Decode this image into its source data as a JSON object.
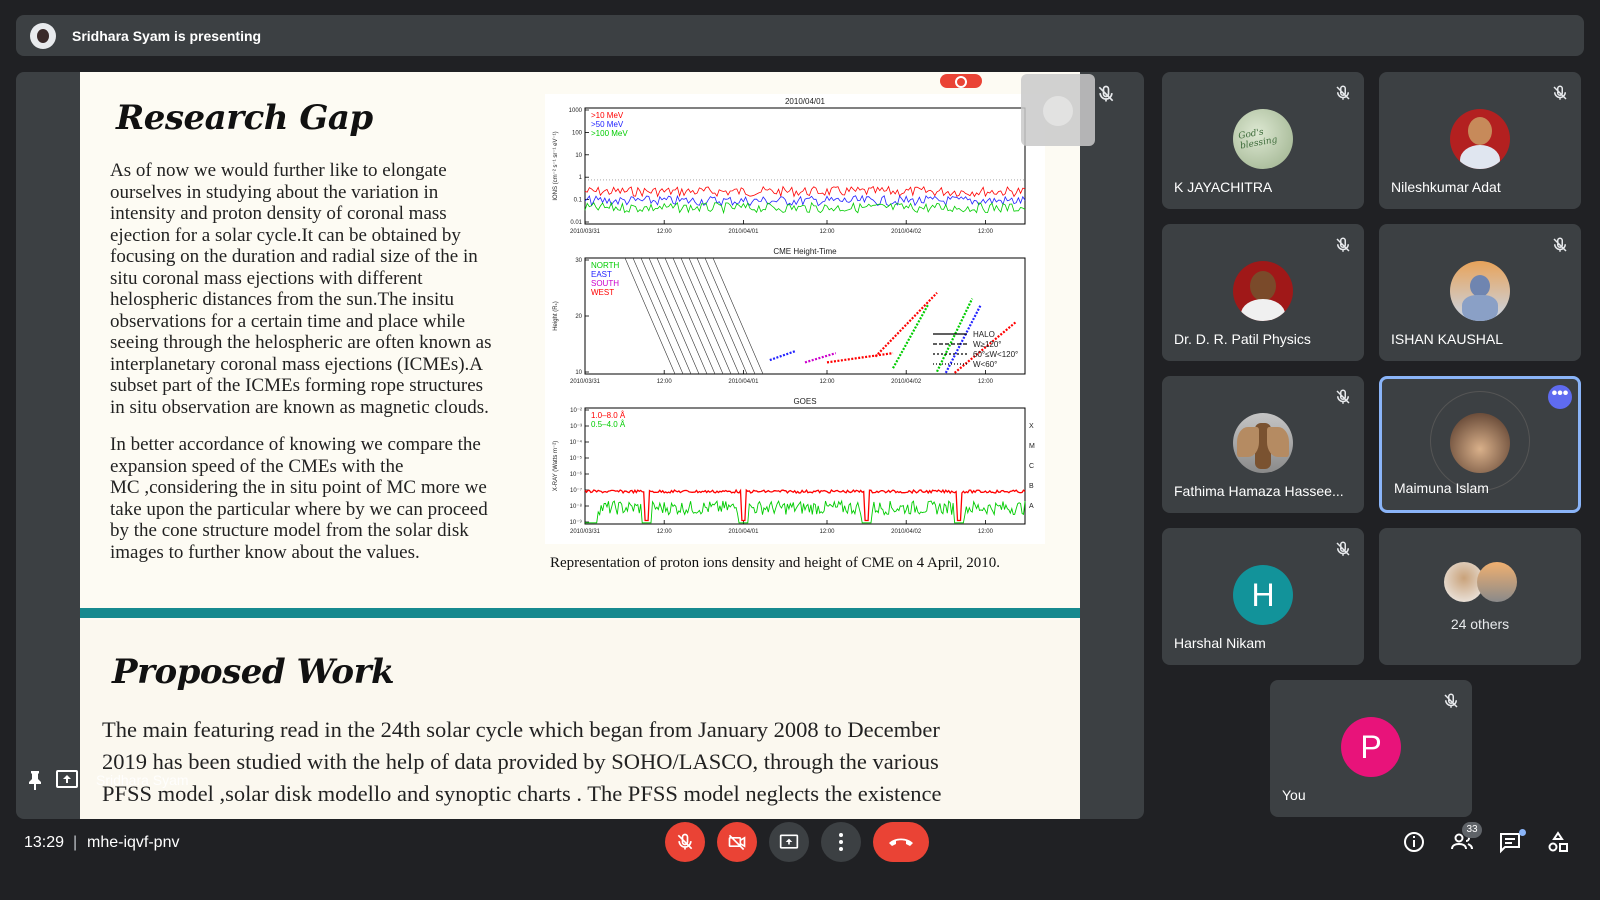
{
  "banner": {
    "text": "Sridhara Syam is presenting"
  },
  "slide": {
    "title1": "Research Gap",
    "para1": [
      "As of now we would further like to elongate",
      "ourselves in studying about the variation in",
      "intensity and proton density of coronal mass",
      "ejection for a solar cycle.It can be obtained by",
      "focusing on the duration and radial size of the in",
      "situ coronal mass ejections with different",
      "helospheric distances from the sun.The insitu",
      "observations for a certain time and place while",
      "seeing through the helospheric are often known as",
      "interplanetary coronal mass ejections (ICMEs).A",
      "subset part of the ICMEs forming rope structures",
      "in situ observation are known as magnetic clouds."
    ],
    "para2": [
      "In better accordance of knowing we compare the",
      "expansion speed of the CMEs with the",
      "MC ,considering the in situ point of MC more we",
      "take upon the particular where by  we can proceed",
      "by the cone structure model from the solar disk",
      "images to further know about the values."
    ],
    "caption": "Representation of proton ions density and height of CME on 4 April, 2010.",
    "title2": "Proposed Work",
    "para3": [
      "The main featuring read in the 24th solar cycle which began from January 2008 to December",
      "2019 has been studied with the help of data provided by SOHO/LASCO, through the various",
      "PFSS model ,solar disk modello and synoptic charts . The PFSS model neglects the existence"
    ],
    "presenter_label": "Sridhara Syam"
  },
  "chart_data": [
    {
      "type": "line",
      "title": "2010/04/01",
      "ylabel": "IONS (cm⁻² s⁻¹ sr⁻¹ eV⁻¹)",
      "y_ticks": [
        "1000",
        "100",
        "10",
        "1",
        "0.1",
        "0.01"
      ],
      "x_ticks": [
        "2010/03/31",
        "12:00",
        "2010/04/01",
        "12:00",
        "2010/04/02",
        "12:00"
      ],
      "series": [
        {
          "name": ">10 MeV",
          "color": "#ff0000"
        },
        {
          "name": ">50 MeV",
          "color": "#2222ff"
        },
        {
          "name": ">100 MeV",
          "color": "#00cc00"
        }
      ]
    },
    {
      "type": "scatter",
      "title": "CME Height-Time",
      "ylabel": "Height (Rₛ)",
      "y_ticks": [
        "30",
        "20",
        "10"
      ],
      "x_ticks": [
        "2010/03/31",
        "12:00",
        "2010/04/01",
        "12:00",
        "2010/04/02",
        "12:00"
      ],
      "series": [
        {
          "name": "NORTH",
          "color": "#00cc00"
        },
        {
          "name": "EAST",
          "color": "#2222ff"
        },
        {
          "name": "SOUTH",
          "color": "#cc00cc"
        },
        {
          "name": "WEST",
          "color": "#ff0000"
        }
      ],
      "legend2": [
        "HALO",
        "W≥120°",
        "60°≤W<120°",
        "W<60°"
      ]
    },
    {
      "type": "line",
      "title": "GOES",
      "ylabel": "X-RAY (Watts m⁻²)",
      "y_ticks": [
        "10⁻²",
        "10⁻³",
        "10⁻⁴",
        "10⁻⁵",
        "10⁻⁶",
        "10⁻⁷",
        "10⁻⁸",
        "10⁻⁹"
      ],
      "right_ticks": [
        "X",
        "M",
        "C",
        "B",
        "A"
      ],
      "x_ticks": [
        "2010/03/31",
        "12:00",
        "2010/04/01",
        "12:00",
        "2010/04/02",
        "12:00"
      ],
      "series": [
        {
          "name": "1.0–8.0 Å",
          "color": "#ff0000"
        },
        {
          "name": "0.5–4.0 Å",
          "color": "#00cc00"
        }
      ]
    }
  ],
  "participants": [
    {
      "name": "K JAYACHITRA",
      "avatar": "text-image"
    },
    {
      "name": "Nileshkumar Adat",
      "avatar": "photo"
    },
    {
      "name": "Dr. D. R. Patil Physics",
      "avatar": "photo"
    },
    {
      "name": "ISHAN KAUSHAL",
      "avatar": "photo"
    },
    {
      "name": "Fathima Hamaza Hassee...",
      "avatar": "photo"
    },
    {
      "name": "Maimuna Islam",
      "avatar": "photo",
      "active": true
    },
    {
      "name": "Harshal Nikam",
      "letter": "H",
      "color": "#12939a"
    }
  ],
  "others": {
    "label": "24 others"
  },
  "self": {
    "name": "You",
    "letter": "P",
    "color": "#e8137a"
  },
  "bottom": {
    "time": "13:29",
    "separator": "|",
    "meeting_code": "mhe-iqvf-pnv",
    "people_count": "33"
  }
}
